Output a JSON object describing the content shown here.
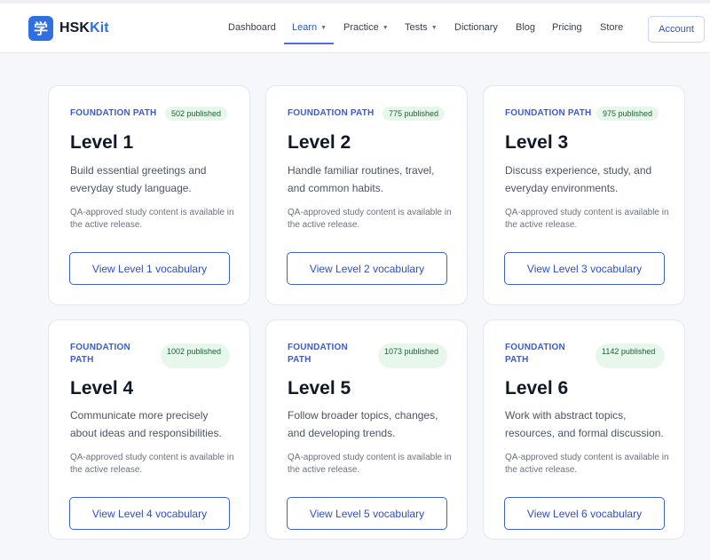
{
  "header": {
    "brand_prefix": "HSK",
    "brand_suffix": "Kit",
    "logo_glyph": "学",
    "logo_icon": "book-logo-icon",
    "nav": [
      {
        "label": "Dashboard",
        "dropdown": false
      },
      {
        "label": "Learn",
        "dropdown": true,
        "active": true
      },
      {
        "label": "Practice",
        "dropdown": true
      },
      {
        "label": "Tests",
        "dropdown": true
      },
      {
        "label": "Dictionary",
        "dropdown": false
      },
      {
        "label": "Blog",
        "dropdown": false
      },
      {
        "label": "Pricing",
        "dropdown": false
      },
      {
        "label": "Store",
        "dropdown": false
      }
    ],
    "caret": "▼",
    "account_label": "Account"
  },
  "cards": [
    {
      "eyebrow": "FOUNDATION PATH",
      "badge": "502 published",
      "title": "Level 1",
      "description": "Build essential greetings and everyday study language.",
      "note": "QA-approved study content is available in the active release.",
      "button": "View Level 1 vocabulary"
    },
    {
      "eyebrow": "FOUNDATION PATH",
      "badge": "775 published",
      "title": "Level 2",
      "description": "Handle familiar routines, travel, and common habits.",
      "note": "QA-approved study content is available in the active release.",
      "button": "View Level 2 vocabulary"
    },
    {
      "eyebrow": "FOUNDATION PATH",
      "badge": "975 published",
      "title": "Level 3",
      "description": "Discuss experience, study, and everyday environments.",
      "note": "QA-approved study content is available in the active release.",
      "button": "View Level 3 vocabulary"
    },
    {
      "eyebrow": "FOUNDATION PATH",
      "badge": "1002 published",
      "title": "Level 4",
      "description": "Communicate more precisely about ideas and responsibilities.",
      "note": "QA-approved study content is available in the active release.",
      "button": "View Level 4 vocabulary"
    },
    {
      "eyebrow": "FOUNDATION PATH",
      "badge": "1073 published",
      "title": "Level 5",
      "description": "Follow broader topics, changes, and developing trends.",
      "note": "QA-approved study content is available in the active release.",
      "button": "View Level 5 vocabulary"
    },
    {
      "eyebrow": "FOUNDATION PATH",
      "badge": "1142 published",
      "title": "Level 6",
      "description": "Work with abstract topics, resources, and formal discussion.",
      "note": "QA-approved study content is available in the active release.",
      "button": "View Level 6 vocabulary"
    }
  ]
}
